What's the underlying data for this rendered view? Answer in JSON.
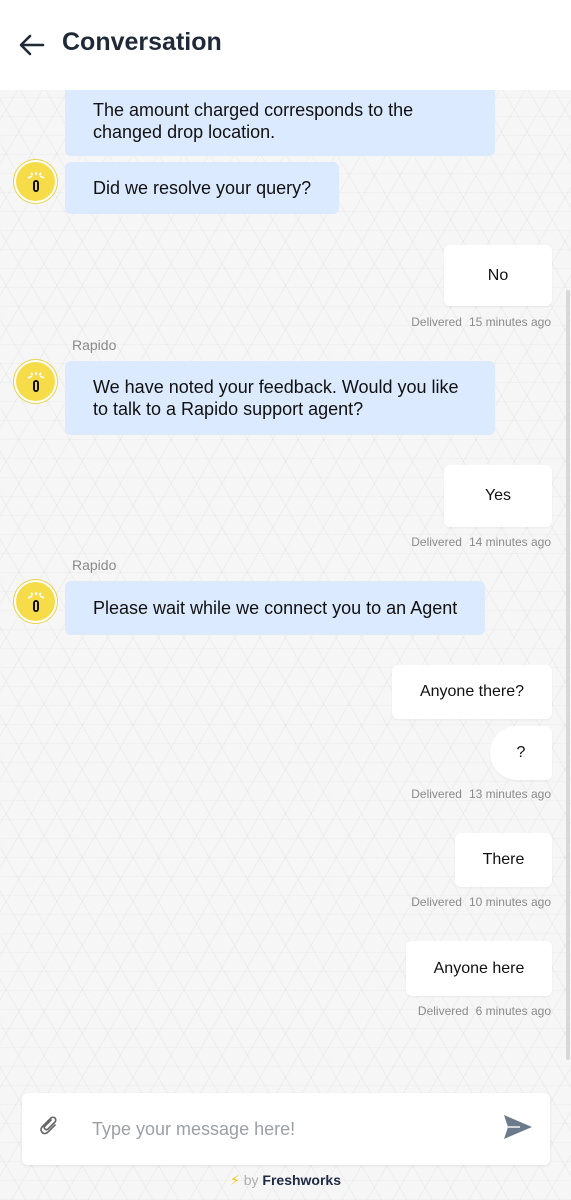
{
  "header": {
    "title": "Conversation",
    "back_icon": "arrow-left-icon"
  },
  "messages": [
    {
      "from": "bot",
      "text": "The amount charged corresponds to the changed drop location."
    },
    {
      "from": "bot",
      "text": "Did we resolve your query?"
    },
    {
      "from": "user",
      "text": "No",
      "status": "Delivered",
      "time": "15 minutes ago"
    },
    {
      "from": "bot",
      "sender": "Rapido",
      "text": "We have noted your feedback. Would you like to talk to a Rapido support agent?"
    },
    {
      "from": "user",
      "text": "Yes",
      "status": "Delivered",
      "time": "14 minutes ago"
    },
    {
      "from": "bot",
      "sender": "Rapido",
      "text": "Please wait while we connect you to an Agent"
    },
    {
      "from": "user",
      "text": "Anyone there?"
    },
    {
      "from": "user",
      "text": "?",
      "status": "Delivered",
      "time": "13 minutes ago"
    },
    {
      "from": "user",
      "text": "There",
      "status": "Delivered",
      "time": "10 minutes ago"
    },
    {
      "from": "user",
      "text": "Anyone here",
      "status": "Delivered",
      "time": "6 minutes ago"
    }
  ],
  "composer": {
    "placeholder": "Type your message here!",
    "attach_icon": "paperclip-icon",
    "send_icon": "send-icon"
  },
  "footer": {
    "by": "by",
    "brand": "Freshworks"
  },
  "colors": {
    "bot_bubble": "#dbeafe",
    "user_bubble": "#ffffff",
    "avatar": "#f7dc4a",
    "accent": "#6b7b8c"
  }
}
